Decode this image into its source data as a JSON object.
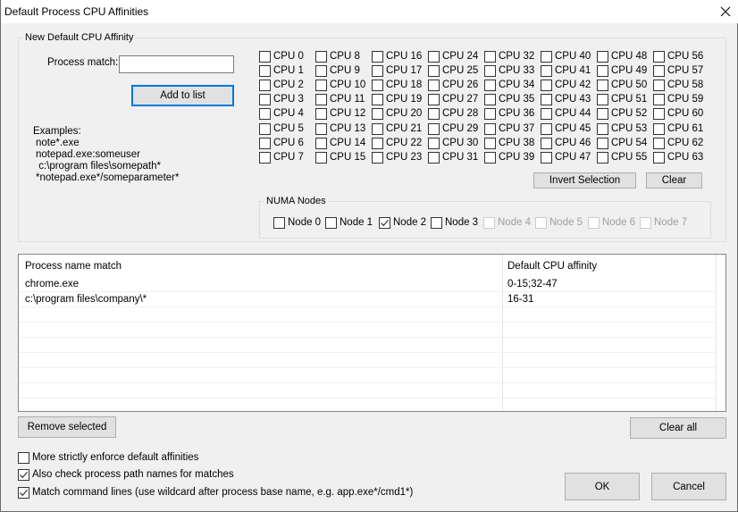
{
  "window": {
    "title": "Default Process CPU Affinities"
  },
  "new_affinity": {
    "group_label": "New Default CPU Affinity",
    "process_match_label": "Process match:",
    "process_match_value": "",
    "add_button": "Add to list",
    "examples_title": "Examples:",
    "examples": [
      "note*.exe",
      "notepad.exe:someuser",
      " c:\\program files\\somepath*",
      "*notepad.exe*/someparameter*"
    ]
  },
  "cpus": [
    {
      "label": "CPU 0",
      "checked": false
    },
    {
      "label": "CPU 1",
      "checked": false
    },
    {
      "label": "CPU 2",
      "checked": false
    },
    {
      "label": "CPU 3",
      "checked": false
    },
    {
      "label": "CPU 4",
      "checked": false
    },
    {
      "label": "CPU 5",
      "checked": false
    },
    {
      "label": "CPU 6",
      "checked": false
    },
    {
      "label": "CPU 7",
      "checked": false
    },
    {
      "label": "CPU 8",
      "checked": false
    },
    {
      "label": "CPU 9",
      "checked": false
    },
    {
      "label": "CPU 10",
      "checked": false
    },
    {
      "label": "CPU 11",
      "checked": false
    },
    {
      "label": "CPU 12",
      "checked": false
    },
    {
      "label": "CPU 13",
      "checked": false
    },
    {
      "label": "CPU 14",
      "checked": false
    },
    {
      "label": "CPU 15",
      "checked": false
    },
    {
      "label": "CPU 16",
      "checked": false
    },
    {
      "label": "CPU 17",
      "checked": false
    },
    {
      "label": "CPU 18",
      "checked": false
    },
    {
      "label": "CPU 19",
      "checked": false
    },
    {
      "label": "CPU 20",
      "checked": false
    },
    {
      "label": "CPU 21",
      "checked": false
    },
    {
      "label": "CPU 22",
      "checked": false
    },
    {
      "label": "CPU 23",
      "checked": false
    },
    {
      "label": "CPU 24",
      "checked": false
    },
    {
      "label": "CPU 25",
      "checked": false
    },
    {
      "label": "CPU 26",
      "checked": false
    },
    {
      "label": "CPU 27",
      "checked": false
    },
    {
      "label": "CPU 28",
      "checked": false
    },
    {
      "label": "CPU 29",
      "checked": false
    },
    {
      "label": "CPU 30",
      "checked": false
    },
    {
      "label": "CPU 31",
      "checked": false
    },
    {
      "label": "CPU 32",
      "checked": false
    },
    {
      "label": "CPU 33",
      "checked": false
    },
    {
      "label": "CPU 34",
      "checked": false
    },
    {
      "label": "CPU 35",
      "checked": false
    },
    {
      "label": "CPU 36",
      "checked": false
    },
    {
      "label": "CPU 37",
      "checked": false
    },
    {
      "label": "CPU 38",
      "checked": false
    },
    {
      "label": "CPU 39",
      "checked": false
    },
    {
      "label": "CPU 40",
      "checked": false
    },
    {
      "label": "CPU 41",
      "checked": false
    },
    {
      "label": "CPU 42",
      "checked": false
    },
    {
      "label": "CPU 43",
      "checked": false
    },
    {
      "label": "CPU 44",
      "checked": false
    },
    {
      "label": "CPU 45",
      "checked": false
    },
    {
      "label": "CPU 46",
      "checked": false
    },
    {
      "label": "CPU 47",
      "checked": false
    },
    {
      "label": "CPU 48",
      "checked": false
    },
    {
      "label": "CPU 49",
      "checked": false
    },
    {
      "label": "CPU 50",
      "checked": false
    },
    {
      "label": "CPU 51",
      "checked": false
    },
    {
      "label": "CPU 52",
      "checked": false
    },
    {
      "label": "CPU 53",
      "checked": false
    },
    {
      "label": "CPU 54",
      "checked": false
    },
    {
      "label": "CPU 55",
      "checked": false
    },
    {
      "label": "CPU 56",
      "checked": false
    },
    {
      "label": "CPU 57",
      "checked": false
    },
    {
      "label": "CPU 58",
      "checked": false
    },
    {
      "label": "CPU 59",
      "checked": false
    },
    {
      "label": "CPU 60",
      "checked": false
    },
    {
      "label": "CPU 61",
      "checked": false
    },
    {
      "label": "CPU 62",
      "checked": false
    },
    {
      "label": "CPU 63",
      "checked": false
    }
  ],
  "cpu_buttons": {
    "invert": "Invert Selection",
    "clear": "Clear"
  },
  "numa": {
    "group_label": "NUMA Nodes",
    "nodes": [
      {
        "label": "Node 0",
        "checked": false,
        "enabled": true
      },
      {
        "label": "Node 1",
        "checked": false,
        "enabled": true
      },
      {
        "label": "Node 2",
        "checked": true,
        "enabled": true
      },
      {
        "label": "Node 3",
        "checked": false,
        "enabled": true
      },
      {
        "label": "Node 4",
        "checked": false,
        "enabled": false
      },
      {
        "label": "Node 5",
        "checked": false,
        "enabled": false
      },
      {
        "label": "Node 6",
        "checked": false,
        "enabled": false
      },
      {
        "label": "Node 7",
        "checked": false,
        "enabled": false
      }
    ]
  },
  "list": {
    "columns": [
      "Process name match",
      "Default CPU affinity"
    ],
    "rows": [
      [
        "chrome.exe",
        "0-15;32-47"
      ],
      [
        "c:\\program files\\company\\*",
        "16-31"
      ]
    ]
  },
  "list_buttons": {
    "remove_selected": "Remove selected",
    "clear_all": "Clear all"
  },
  "options": [
    {
      "label": "More strictly enforce default affinities",
      "checked": false
    },
    {
      "label": "Also check process path names for matches",
      "checked": true
    },
    {
      "label": "Match command lines (use wildcard after process base name, e.g. app.exe*/cmd1*)",
      "checked": true
    }
  ],
  "dialog_buttons": {
    "ok": "OK",
    "cancel": "Cancel"
  }
}
